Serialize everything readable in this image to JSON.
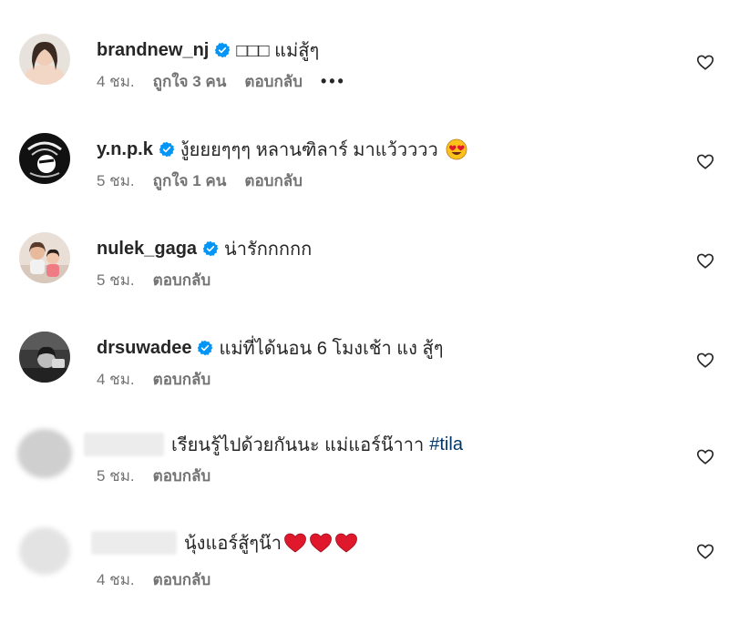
{
  "comments": [
    {
      "username": "brandnew_nj",
      "text": "□□□ แม่สู้ๆ",
      "time": "4 ชม.",
      "likes": "ถูกใจ 3 คน",
      "reply": "ตอบกลับ",
      "more": "•••"
    },
    {
      "username": "y.n.p.k",
      "text": "งู้ยยยๆๆๆ หลานฑิลาร์ มาแว้วววว",
      "time": "5 ชม.",
      "likes": "ถูกใจ 1 คน",
      "reply": "ตอบกลับ"
    },
    {
      "username": "nulek_gaga",
      "text": "น่ารักกกกก",
      "time": "5 ชม.",
      "reply": "ตอบกลับ"
    },
    {
      "username": "drsuwadee",
      "text": "แม่ที่ได้นอน 6 โมงเช้า แง สู้ๆ",
      "time": "4 ชม.",
      "reply": "ตอบกลับ"
    },
    {
      "text": "เรียนรู้ไปด้วยกันนะ แม่แอร์น๊าาา",
      "hashtag": "#tila",
      "time": "5 ชม.",
      "reply": "ตอบกลับ"
    },
    {
      "text": "นุ้งแอร์สู้ๆน๊า",
      "time": "4 ชม.",
      "reply": "ตอบกลับ"
    }
  ],
  "icons": {
    "verified": "verified-badge-icon",
    "like": "heart-outline-icon",
    "emoji_heart_eyes": "heart-eyes-emoji-icon",
    "emoji_red_heart": "red-heart-emoji-icon"
  },
  "colors": {
    "verified_blue": "#0095f6",
    "meta_gray": "#737373",
    "hashtag_blue": "#00376b",
    "heart_red": "#e0182b"
  }
}
